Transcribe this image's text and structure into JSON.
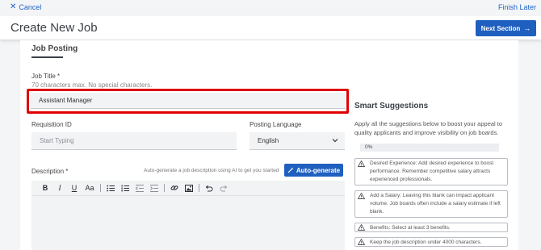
{
  "topbar": {
    "cancel_label": "Cancel",
    "finish_label": "Finish Later"
  },
  "header": {
    "title": "Create New Job",
    "next_label": "Next Section"
  },
  "section": {
    "title": "Job Posting"
  },
  "job_title": {
    "label": "Job Title *",
    "hint": "70 characters max. No special characters.",
    "value": "Assistant Manager"
  },
  "requisition": {
    "label": "Requisition ID",
    "placeholder": "Start Typing"
  },
  "posting_language": {
    "label": "Posting Language",
    "value": "English"
  },
  "description": {
    "label": "Description *",
    "autogen_hint": "Auto-generate a job description using AI to get you started",
    "autogen_label": "Auto-generate"
  },
  "toolbar": {
    "bold": "B",
    "italic": "I",
    "underline": "U",
    "font_size": "Aa"
  },
  "smart": {
    "title": "Smart Suggestions",
    "description": "Apply all the suggestions below to boost your appeal to quality applicants and improve visibility on job boards.",
    "progress_label": "0%",
    "progress_value": 0,
    "suggestions": [
      {
        "text": "Desired Experience: Add desired experience to boost performance. Remember competitive salary attracts experienced professionals."
      },
      {
        "text": "Add a Salary: Leaving this blank can impact applicant volume. Job boards often include a salary estimate if left blank."
      },
      {
        "text": "Benefits: Select at least 3 benefits."
      },
      {
        "text": "Keep the job description under 4000 characters."
      }
    ]
  },
  "colors": {
    "accent": "#1f5fbf",
    "highlight": "#e00000"
  }
}
